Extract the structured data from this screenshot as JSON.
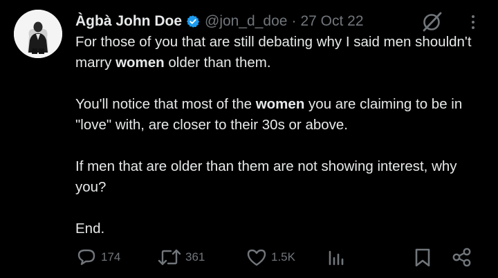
{
  "author": {
    "display_name": "Àgbà John Doe",
    "handle": "@jon_d_doe",
    "separator": "·",
    "date": "27 Oct 22"
  },
  "tweet": {
    "p1_a": "For those of you that are still debating why I said men shouldn't marry ",
    "p1_hl": "women",
    "p1_b": " older than them.",
    "p2_a": "You'll notice that most of the ",
    "p2_hl": "women",
    "p2_b": " you are claiming to be in \"love\" with, are closer to their 30s or above.",
    "p3": "If men that are older than them are not showing interest, why you?",
    "p4": "End."
  },
  "stats": {
    "replies": "174",
    "reposts": "361",
    "likes": "1.5K"
  },
  "icons": {
    "verified": "verified-badge-icon",
    "grok": "grok-icon",
    "more": "more-dots-icon",
    "reply": "reply-bubble-icon",
    "repost": "repost-icon",
    "like": "heart-icon",
    "views": "views-chart-icon",
    "bookmark": "bookmark-icon",
    "share": "share-icon"
  },
  "colors": {
    "background": "#000000",
    "text": "#e7e9ea",
    "secondary": "#71767b",
    "verified": "#1d9bf0"
  }
}
